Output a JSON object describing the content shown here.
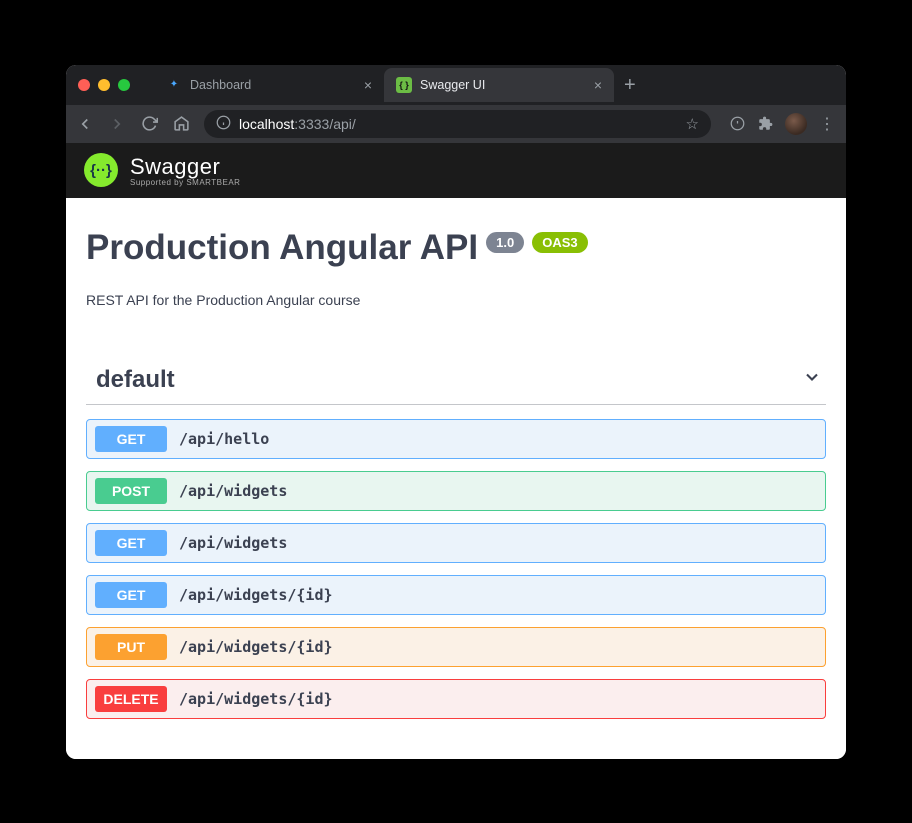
{
  "browser": {
    "tabs": [
      {
        "title": "Dashboard",
        "active": false
      },
      {
        "title": "Swagger UI",
        "active": true
      }
    ],
    "url": {
      "scheme_host_dim": "localhost",
      "port": ":3333",
      "path": "/api/"
    }
  },
  "swagger_header": {
    "brand_main": "Swagger",
    "brand_sub": "Supported by SMARTBEAR"
  },
  "api": {
    "title": "Production Angular API",
    "version": "1.0",
    "oas": "OAS3",
    "description": "REST API for the Production Angular course",
    "tag": "default",
    "operations": [
      {
        "method": "GET",
        "path": "/api/hello",
        "kind": "get"
      },
      {
        "method": "POST",
        "path": "/api/widgets",
        "kind": "post"
      },
      {
        "method": "GET",
        "path": "/api/widgets",
        "kind": "get"
      },
      {
        "method": "GET",
        "path": "/api/widgets/{id}",
        "kind": "get"
      },
      {
        "method": "PUT",
        "path": "/api/widgets/{id}",
        "kind": "put"
      },
      {
        "method": "DELETE",
        "path": "/api/widgets/{id}",
        "kind": "delete"
      }
    ]
  }
}
